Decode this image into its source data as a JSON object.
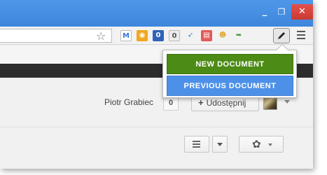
{
  "window": {
    "minimize_glyph": "_",
    "maximize_glyph": "❐",
    "close_glyph": "✕",
    "colors": {
      "titlebar": "#3d86dc",
      "close": "#d64a43"
    }
  },
  "toolbar": {
    "bookmark_icon": "star-icon",
    "extensions": [
      {
        "name": "gmail-icon",
        "glyph": "M",
        "color": "#ffffff",
        "text_color": "#3a78d6"
      },
      {
        "name": "calendar-icon",
        "glyph": "◉",
        "color": "#f0a81e",
        "text_color": "#ffffff"
      },
      {
        "name": "count-badge-icon",
        "glyph": "0",
        "color": "#2f63b8",
        "text_color": "#ffffff"
      },
      {
        "name": "gray-badge-icon",
        "glyph": "0",
        "color": "#ececec",
        "text_color": "#555555"
      },
      {
        "name": "bird-icon",
        "glyph": "➶",
        "color": "#f2f2f2",
        "text_color": "#3f87d8"
      },
      {
        "name": "notes-icon",
        "glyph": "▤",
        "color": "#e35a5a",
        "text_color": "#ffffff"
      },
      {
        "name": "cookie-icon",
        "glyph": "☻",
        "color": "#f2f2f2",
        "text_color": "#e0a93a"
      },
      {
        "name": "send-icon",
        "glyph": "➥",
        "color": "#f2f2f2",
        "text_color": "#4a9a3a"
      }
    ],
    "pencil_glyph": "✎"
  },
  "dropdown": {
    "new_document": "NEW DOCUMENT",
    "previous_document": "PREVIOUS DOCUMENT",
    "colors": {
      "new": "#4c8b15",
      "previous": "#4d90e8"
    }
  },
  "user": {
    "name": "Piotr Grabiec",
    "notification_count": "0",
    "share_label": "Udostępnij",
    "share_prefix": "+"
  },
  "view_controls": {
    "list_icon": "list-icon",
    "settings_glyph": "✿"
  }
}
